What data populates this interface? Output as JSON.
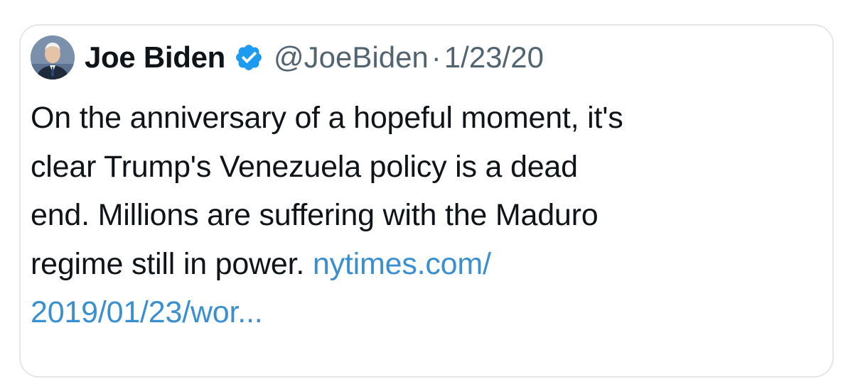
{
  "tweet": {
    "author": {
      "name": "Joe Biden",
      "handle": "@JoeBiden",
      "verified": true,
      "avatar_icon": "avatar-portrait-icon",
      "badge_icon": "verified-badge-icon"
    },
    "separator": "·",
    "timestamp": "1/23/20",
    "text_lines": [
      "On the anniversary of a hopeful moment, it's",
      "clear Trump's Venezuela policy is a dead",
      "end. Millions are suffering with the Maduro",
      "regime still in power. "
    ],
    "link": {
      "line1": "nytimes.com/",
      "line2": "2019/01/23/wor..."
    },
    "colors": {
      "text": "#0f1419",
      "secondary": "#536471",
      "link": "#3a8fd1",
      "verified": "#1d9bf0",
      "border": "#e4e7ea"
    }
  }
}
